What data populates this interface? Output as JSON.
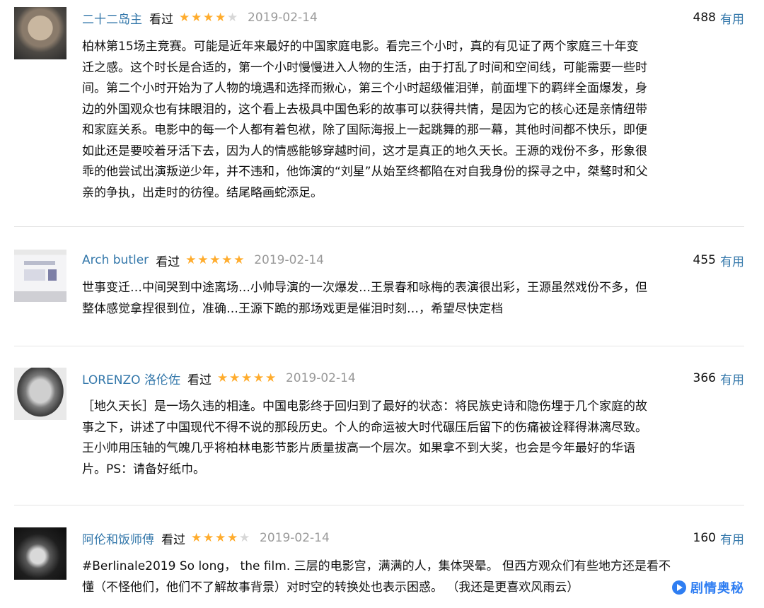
{
  "reviews": [
    {
      "user": "二十二岛主",
      "status": "看过",
      "rating": 4,
      "date": "2019-02-14",
      "votes": "488",
      "useful_label": "有用",
      "avatar_icon": "user-avatar",
      "lines": [
        "柏林第15场主竞赛。可能是近年来最好的中国家庭电影。看完三个小时，真的有见证了两个家庭三十年变",
        "迁之感。这个时长是合适的，第一个小时慢慢进入人物的生活，由于打乱了时间和空间线，可能需要一些时",
        "间。第二个小时开始为了人物的境遇和选择而揪心，第三个小时超级催泪弹，前面埋下的羁绊全面爆发，身",
        "边的外国观众也有抹眼泪的，这个看上去极具中国色彩的故事可以获得共情，是因为它的核心还是亲情纽带",
        "和家庭关系。电影中的每一个人都有着包袱，除了国际海报上一起跳舞的那一幕，其他时间都不快乐，即便",
        "如此还是要咬着牙活下去，因为人的情感能够穿越时间，这才是真正的地久天长。王源的戏份不多，形象很",
        "乖的他尝试出演叛逆少年，并不违和，他饰演的“刘星”从始至终都陷在对自我身份的探寻之中，桀骜时和父",
        "亲的争执，出走时的彷徨。结尾略画蛇添足。"
      ]
    },
    {
      "user": "Arch butler",
      "status": "看过",
      "rating": 5,
      "date": "2019-02-14",
      "votes": "455",
      "useful_label": "有用",
      "avatar_icon": "user-avatar",
      "lines": [
        "世事变迁…中间哭到中途离场…小帅导演的一次爆发…王景春和咏梅的表演很出彩，王源虽然戏份不多，但",
        "整体感觉拿捏很到位，准确…王源下跪的那场戏更是催泪时刻…，希望尽快定档"
      ]
    },
    {
      "user": "LORENZO 洛伦佐",
      "status": "看过",
      "rating": 5,
      "date": "2019-02-14",
      "votes": "366",
      "useful_label": "有用",
      "avatar_icon": "user-avatar",
      "lines": [
        "［地久天长］是一场久违的相逢。中国电影终于回归到了最好的状态：将民族史诗和隐伤埋于几个家庭的故",
        "事之下，讲述了中国现代不得不说的那段历史。个人的命运被大时代碾压后留下的伤痛被诠释得淋漓尽致。",
        "王小帅用压轴的气魄几乎将柏林电影节影片质量拔高一个层次。如果拿不到大奖，也会是今年最好的华语",
        "片。PS：请备好纸巾。"
      ]
    },
    {
      "user": "阿伦和饭师傅",
      "status": "看过",
      "rating": 4,
      "date": "2019-02-14",
      "votes": "160",
      "useful_label": "有用",
      "avatar_icon": "user-avatar",
      "lines": [
        "#Berlinale2019 So long， the film. 三层的电影宫，满满的人，集体哭晕。 但西方观众们有些地方还是看不",
        "懂（不怪他们，他们不了解故事背景）对时空的转换处也表示困惑。 （我还是更喜欢风雨云）"
      ]
    }
  ],
  "watermark": {
    "text": "剧情奥秘",
    "icon": "play-badge-icon"
  },
  "colors": {
    "link": "#3377aa",
    "star": "#ffac2d",
    "date": "#999999",
    "divider": "#e5e5e5"
  }
}
